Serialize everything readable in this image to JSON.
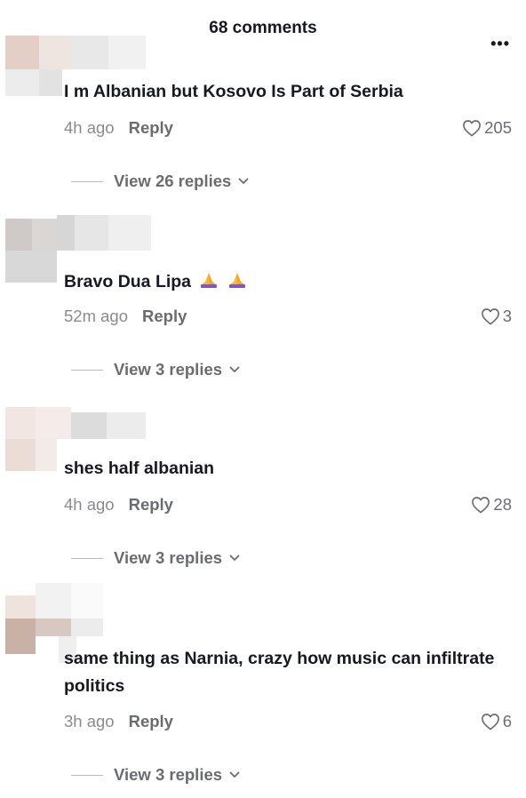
{
  "header": {
    "title": "68 comments",
    "more_label": "•••"
  },
  "comments": [
    {
      "text": "I m Albanian but Kosovo Is Part of Serbia",
      "time": "4h ago",
      "reply": "Reply",
      "likes": "205",
      "view": "View 26 replies"
    },
    {
      "text": "Bravo Dua Lipa",
      "emoji_count": 2,
      "time": "52m ago",
      "reply": "Reply",
      "likes": "3",
      "view": "View 3 replies"
    },
    {
      "text": "shes half albanian",
      "time": "4h ago",
      "reply": "Reply",
      "likes": "28",
      "view": "View 3 replies"
    },
    {
      "text": "same thing as Narnia, crazy how music can infiltrate politics",
      "time": "3h ago",
      "reply": "Reply",
      "likes": "6",
      "view": "View 3 replies"
    }
  ],
  "icons": {
    "like": "heart-outline-icon",
    "expand": "chevron-down-icon",
    "emoji": "folded-hands-emoji"
  }
}
